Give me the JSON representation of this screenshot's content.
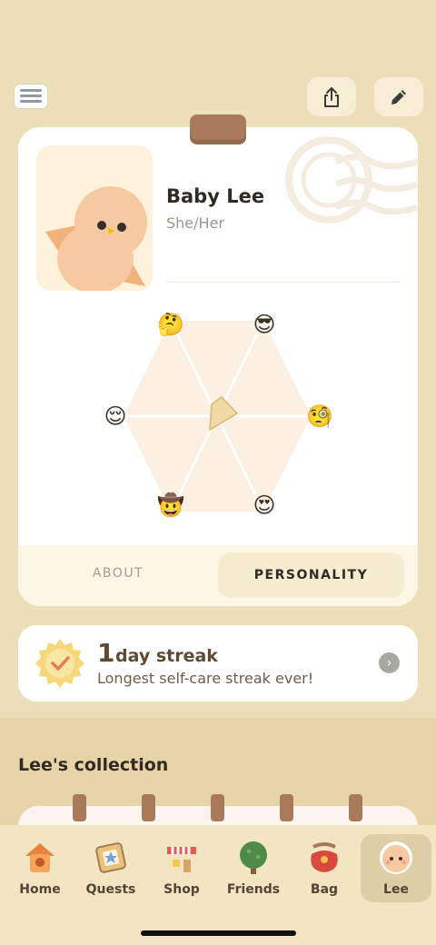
{
  "header": {
    "menu_icon": "hamburger-menu-icon",
    "share_icon": "share-icon",
    "edit_icon": "pencil-icon"
  },
  "profile": {
    "name": "Baby Lee",
    "pronouns": "She/Her",
    "avatar_icon": "baby-bird-icon"
  },
  "personality_chart": {
    "traits": [
      {
        "emoji": "🤔",
        "icon": "thinking-face-icon"
      },
      {
        "emoji": "😎",
        "icon": "sunglasses-face-icon"
      },
      {
        "emoji": "🧐",
        "icon": "monocle-face-icon"
      },
      {
        "emoji": "😍",
        "icon": "heart-eyes-face-icon"
      },
      {
        "emoji": "🤠",
        "icon": "cowboy-face-icon"
      },
      {
        "emoji": "😌",
        "icon": "relieved-face-icon"
      }
    ]
  },
  "tabs": {
    "about": "ABOUT",
    "personality": "PERSONALITY",
    "active": "personality"
  },
  "streak": {
    "count": "1",
    "label": "day streak",
    "subtitle": "Longest self-care streak ever!"
  },
  "collection": {
    "title": "Lee's collection"
  },
  "nav": {
    "items": [
      {
        "label": "Home",
        "icon": "birdhouse-icon"
      },
      {
        "label": "Quests",
        "icon": "quest-scroll-icon"
      },
      {
        "label": "Shop",
        "icon": "shop-icon"
      },
      {
        "label": "Friends",
        "icon": "tree-icon"
      },
      {
        "label": "Bag",
        "icon": "bag-icon"
      },
      {
        "label": "Lee",
        "icon": "bird-face-icon"
      }
    ],
    "active": "Lee"
  },
  "colors": {
    "background": "#ebdfb9",
    "card": "#ffffff",
    "accent_brown": "#a87a5a",
    "nav_active": "#ddcea8"
  }
}
